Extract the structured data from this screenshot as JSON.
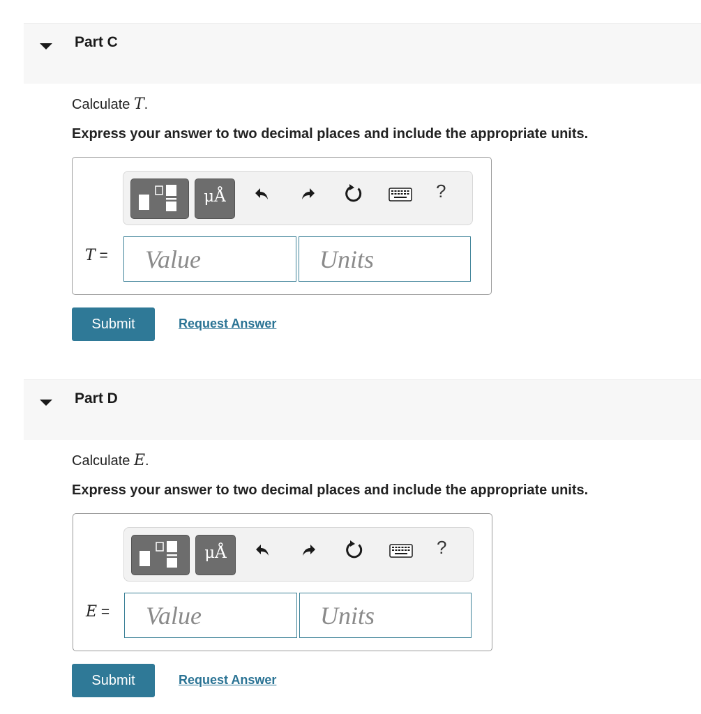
{
  "parts": [
    {
      "title": "Part C",
      "question_prefix": "Calculate ",
      "variable": "T",
      "question_suffix": ".",
      "instructions": "Express your answer to two decimal places and include the appropriate units.",
      "var_label": "T",
      "equals": " =",
      "value_placeholder": "Value",
      "units_placeholder": "Units",
      "submit_label": "Submit",
      "request_label": "Request Answer"
    },
    {
      "title": "Part D",
      "question_prefix": "Calculate ",
      "variable": "E",
      "question_suffix": ".",
      "instructions": "Express your answer to two decimal places and include the appropriate units.",
      "var_label": "E",
      "equals": " =",
      "value_placeholder": "Value",
      "units_placeholder": "Units",
      "submit_label": "Submit",
      "request_label": "Request Answer"
    }
  ],
  "toolbar": {
    "templates_icon": "templates-icon",
    "units_label": "μÅ",
    "undo_icon": "undo-icon",
    "redo_icon": "redo-icon",
    "reset_icon": "reset-icon",
    "keyboard_icon": "keyboard-icon",
    "help_label": "?"
  },
  "colors": {
    "header_bg": "#f7f7f7",
    "accent": "#2f7997",
    "input_border": "#3d8298",
    "toolbar_dark_button": "#6d6d6d"
  }
}
